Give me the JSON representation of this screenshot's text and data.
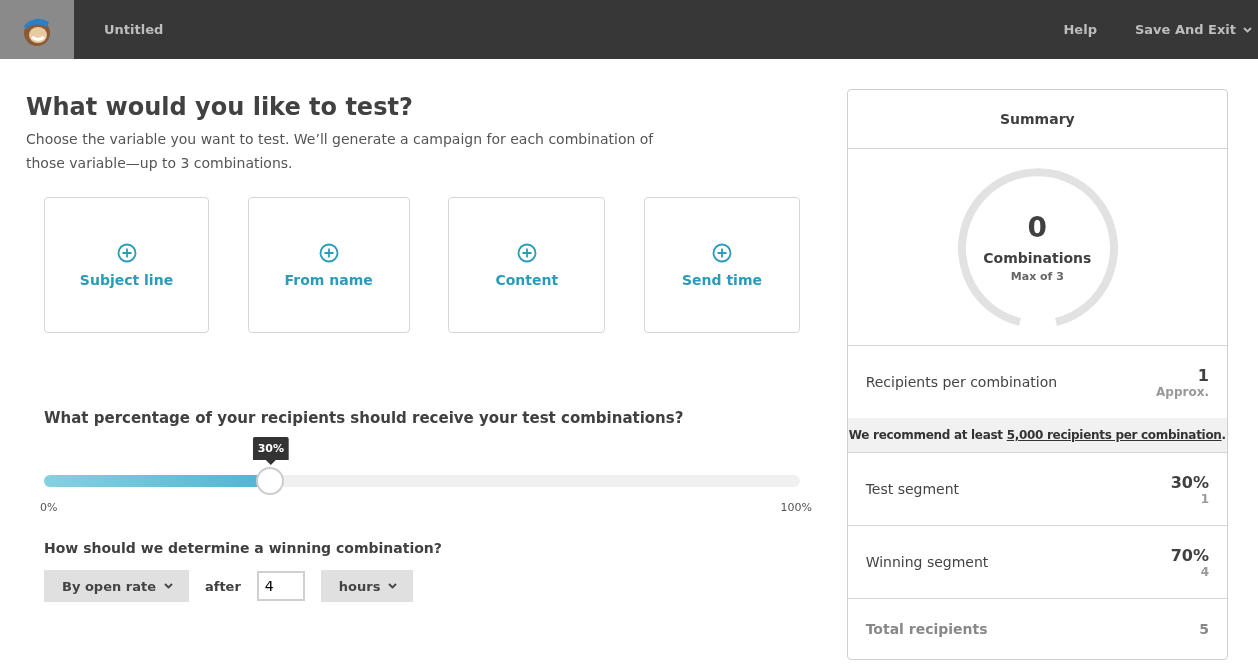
{
  "header": {
    "title": "Untitled",
    "help": "Help",
    "save": "Save And Exit"
  },
  "intro": {
    "heading": "What would you like to test?",
    "description": "Choose the variable you want to test. We’ll generate a campaign for each combination of those variable—up to 3 combinations."
  },
  "variables": [
    {
      "label": "Subject line"
    },
    {
      "label": "From name"
    },
    {
      "label": "Content"
    },
    {
      "label": "Send time"
    }
  ],
  "percentage": {
    "question": "What percentage of your recipients should receive your test combinations?",
    "tooltip": "30%",
    "level": 0.3,
    "min_label": "0%",
    "max_label": "100%"
  },
  "winner": {
    "question": "How should we determine a winning combination?",
    "metric": "By open rate",
    "after": "after",
    "value": "4",
    "unit": "hours"
  },
  "summary": {
    "title": "Summary",
    "count": "0",
    "count_label": "Combinations",
    "max": "Max of 3",
    "recipients": {
      "label": "Recipients per combination",
      "value": "1",
      "note": "Approx."
    },
    "recommend": {
      "text": "We recommend at least",
      "link": "5,000 recipients per combination",
      "end": "."
    },
    "segments": [
      {
        "label": "Test segment",
        "value": "30%",
        "count": "1"
      },
      {
        "label": "Winning segment",
        "value": "70%",
        "count": "4"
      }
    ],
    "total": {
      "label": "Total recipients",
      "value": "5"
    }
  }
}
